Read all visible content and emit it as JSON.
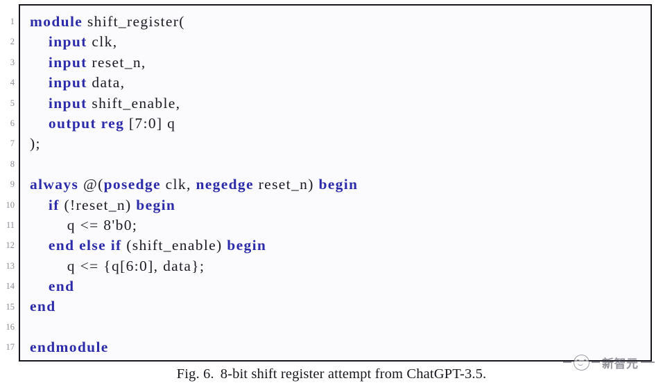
{
  "figure": {
    "caption_label": "Fig. 6.",
    "caption_text": "8-bit shift register attempt from ChatGPT-3.5.",
    "border_color": "#16161c",
    "background_color": "#fbfbfe"
  },
  "code": {
    "language": "verilog",
    "keyword_color": "#2c2cab",
    "plain_color": "#1a1a22",
    "gutter_color": "#8d8d96",
    "line_numbers": [
      "1",
      "2",
      "3",
      "4",
      "5",
      "6",
      "7",
      "8",
      "9",
      "10",
      "11",
      "12",
      "13",
      "14",
      "15",
      "16",
      "17"
    ],
    "lines": [
      {
        "n": "1",
        "text": "module shift_register(",
        "tokens": [
          {
            "t": "kw",
            "v": "module"
          },
          {
            "t": "pl",
            "v": " shift_register("
          }
        ]
      },
      {
        "n": "2",
        "text": "    input clk,",
        "tokens": [
          {
            "t": "pl",
            "v": "    "
          },
          {
            "t": "kw",
            "v": "input"
          },
          {
            "t": "pl",
            "v": " clk,"
          }
        ]
      },
      {
        "n": "3",
        "text": "    input reset_n,",
        "tokens": [
          {
            "t": "pl",
            "v": "    "
          },
          {
            "t": "kw",
            "v": "input"
          },
          {
            "t": "pl",
            "v": " reset_n,"
          }
        ]
      },
      {
        "n": "4",
        "text": "    input data,",
        "tokens": [
          {
            "t": "pl",
            "v": "    "
          },
          {
            "t": "kw",
            "v": "input"
          },
          {
            "t": "pl",
            "v": " data,"
          }
        ]
      },
      {
        "n": "5",
        "text": "    input shift_enable,",
        "tokens": [
          {
            "t": "pl",
            "v": "    "
          },
          {
            "t": "kw",
            "v": "input"
          },
          {
            "t": "pl",
            "v": " shift_enable,"
          }
        ]
      },
      {
        "n": "6",
        "text": "    output reg [7:0] q",
        "tokens": [
          {
            "t": "pl",
            "v": "    "
          },
          {
            "t": "kw",
            "v": "output reg"
          },
          {
            "t": "pl",
            "v": " [7:0] q"
          }
        ]
      },
      {
        "n": "7",
        "text": ");",
        "tokens": [
          {
            "t": "pl",
            "v": ");"
          }
        ]
      },
      {
        "n": "8",
        "text": "",
        "tokens": []
      },
      {
        "n": "9",
        "text": "always @(posedge clk, negedge reset_n) begin",
        "tokens": [
          {
            "t": "kw",
            "v": "always"
          },
          {
            "t": "pl",
            "v": " @("
          },
          {
            "t": "kw",
            "v": "posedge"
          },
          {
            "t": "pl",
            "v": " clk, "
          },
          {
            "t": "kw",
            "v": "negedge"
          },
          {
            "t": "pl",
            "v": " reset_n) "
          },
          {
            "t": "kw",
            "v": "begin"
          }
        ]
      },
      {
        "n": "10",
        "text": "    if (!reset_n) begin",
        "tokens": [
          {
            "t": "pl",
            "v": "    "
          },
          {
            "t": "kw",
            "v": "if"
          },
          {
            "t": "pl",
            "v": " (!reset_n) "
          },
          {
            "t": "kw",
            "v": "begin"
          }
        ]
      },
      {
        "n": "11",
        "text": "        q <= 8'b0;",
        "tokens": [
          {
            "t": "pl",
            "v": "        q <= 8'b0;"
          }
        ]
      },
      {
        "n": "12",
        "text": "    end else if (shift_enable) begin",
        "tokens": [
          {
            "t": "pl",
            "v": "    "
          },
          {
            "t": "kw",
            "v": "end else if"
          },
          {
            "t": "pl",
            "v": " (shift_enable) "
          },
          {
            "t": "kw",
            "v": "begin"
          }
        ]
      },
      {
        "n": "13",
        "text": "        q <= {q[6:0], data};",
        "tokens": [
          {
            "t": "pl",
            "v": "        q <= {q[6:0], data};"
          }
        ]
      },
      {
        "n": "14",
        "text": "    end",
        "tokens": [
          {
            "t": "pl",
            "v": "    "
          },
          {
            "t": "kw",
            "v": "end"
          }
        ]
      },
      {
        "n": "15",
        "text": "end",
        "tokens": [
          {
            "t": "kw",
            "v": "end"
          }
        ]
      },
      {
        "n": "16",
        "text": "",
        "tokens": []
      },
      {
        "n": "17",
        "text": "endmodule",
        "tokens": [
          {
            "t": "kw",
            "v": "endmodule"
          }
        ]
      }
    ]
  },
  "watermark": {
    "text": "新智元",
    "icon": "smiley-face-icon"
  }
}
